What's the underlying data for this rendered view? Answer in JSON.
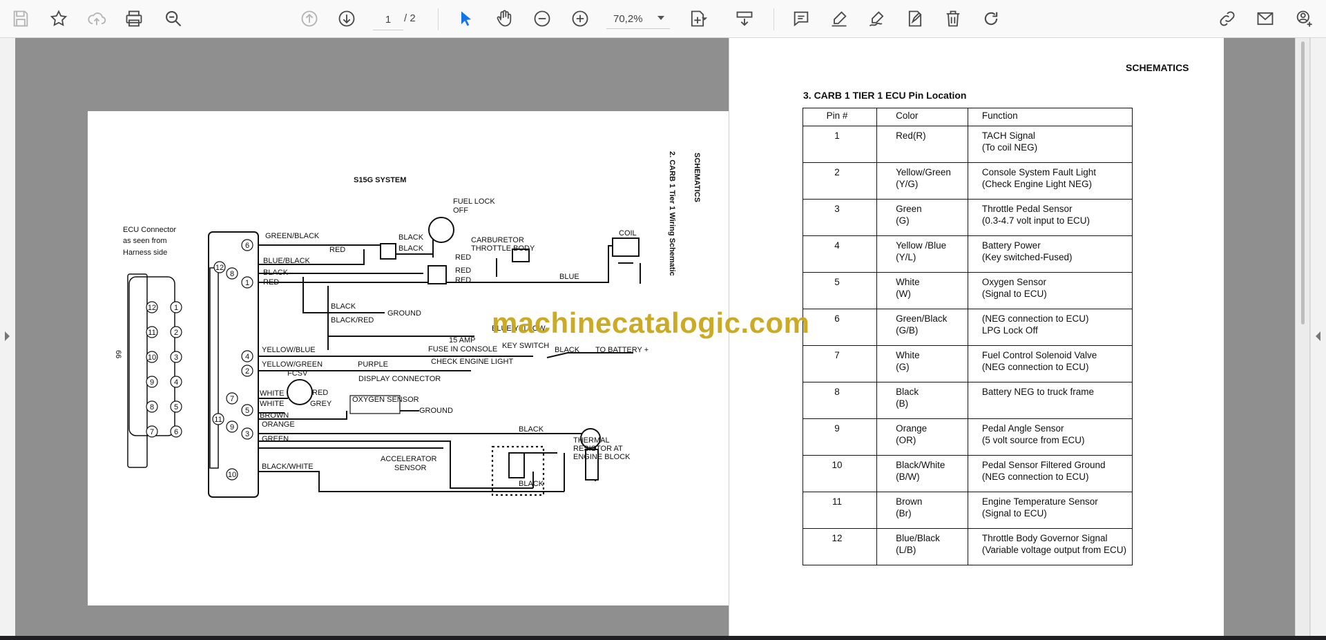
{
  "toolbar": {
    "page_current": "1",
    "page_total": "/ 2",
    "zoom": "70,2%"
  },
  "watermark": "machinecatalogic.com",
  "diagram": {
    "title": "S15G SYSTEM",
    "side_title_1": "SCHEMATICS",
    "side_title_2": "2. CARB 1 Tier 1 Wiring Schematic",
    "page_number": "66",
    "ecu_label_1": "ECU Connector",
    "ecu_label_2": "as seen from",
    "ecu_label_3": "Harness side",
    "labels": {
      "green_black": "GREEN/BLACK",
      "blue_black": "BLUE/BLACK",
      "black1": "BLACK",
      "red1": "RED",
      "red2": "RED",
      "black_a": "BLACK",
      "black_b": "BLACK",
      "red3": "RED",
      "red4": "RED",
      "red5": "RED",
      "blue": "BLUE",
      "fuel_lock_1": "FUEL LOCK",
      "fuel_lock_2": "OFF",
      "carb_1": "CARBURETOR",
      "carb_2": "THROTTLE BODY",
      "coil": "COIL",
      "black_gnd": "BLACK",
      "ground1": "GROUND",
      "black_red": "BLACK/RED",
      "blue_yellow": "BLUE/YELLOW",
      "fuse_1": "15 AMP",
      "fuse_2": "FUSE IN CONSOLE",
      "key_switch": "KEY SWITCH",
      "black_batt": "BLACK",
      "to_battery": "TO BATTERY +",
      "yellow_blue": "YELLOW/BLUE",
      "yellow_green": "YELLOW/GREEN",
      "purple": "PURPLE",
      "check_engine": "CHECK ENGINE LIGHT",
      "display_connector": "DISPLAY CONNECTOR",
      "fcsv": "FCSV",
      "white1": "WHITE",
      "red6": "RED",
      "white2": "WHITE",
      "grey": "GREY",
      "oxygen_sensor": "OXYGEN SENSOR",
      "ground2": "GROUND",
      "brown": "BROWN",
      "orange": "ORANGE",
      "green": "GREEN",
      "black_w1": "BLACK",
      "accel_1": "ACCELERATOR",
      "accel_2": "SENSOR",
      "thermal_1": "THERMAL",
      "thermal_2": "RESISTOR AT",
      "thermal_3": "ENGINE BLOCK",
      "black_white": "BLACK/WHITE",
      "black_w2": "BLACK"
    },
    "ecu_pins": [
      "12",
      "1",
      "11",
      "2",
      "10",
      "3",
      "9",
      "4",
      "8",
      "5",
      "7",
      "6"
    ],
    "harness_pins": [
      "6",
      "12",
      "8",
      "1",
      "4",
      "2",
      "7",
      "5",
      "11",
      "9",
      "3",
      "10"
    ]
  },
  "right_page": {
    "header": "SCHEMATICS",
    "title": "3. CARB 1 TIER 1 ECU Pin Location",
    "columns": [
      "Pin #",
      "Color",
      "Function"
    ],
    "rows": [
      {
        "pin": "1",
        "color": [
          "Red(R)"
        ],
        "function": [
          "TACH Signal",
          "(To coil NEG)"
        ]
      },
      {
        "pin": "2",
        "color": [
          "Yellow/Green",
          "(Y/G)"
        ],
        "function": [
          "Console System Fault Light",
          "(Check Engine Light NEG)"
        ]
      },
      {
        "pin": "3",
        "color": [
          "Green",
          "(G)"
        ],
        "function": [
          "Throttle Pedal Sensor",
          "(0.3-4.7 volt input to ECU)"
        ]
      },
      {
        "pin": "4",
        "color": [
          "Yellow /Blue",
          "(Y/L)"
        ],
        "function": [
          "Battery Power",
          "(Key switched-Fused)"
        ]
      },
      {
        "pin": "5",
        "color": [
          "White",
          "(W)"
        ],
        "function": [
          "Oxygen Sensor",
          "(Signal to ECU)"
        ]
      },
      {
        "pin": "6",
        "color": [
          "Green/Black",
          "(G/B)"
        ],
        "function": [
          "(NEG connection to ECU)",
          "LPG Lock Off"
        ]
      },
      {
        "pin": "7",
        "color": [
          "White",
          "(G)"
        ],
        "function": [
          "Fuel Control Solenoid Valve",
          "(NEG connection to ECU)"
        ]
      },
      {
        "pin": "8",
        "color": [
          "Black",
          "(B)"
        ],
        "function": [
          "Battery NEG to truck frame"
        ]
      },
      {
        "pin": "9",
        "color": [
          "Orange",
          "(OR)"
        ],
        "function": [
          "Pedal Angle Sensor",
          "(5 volt source from ECU)"
        ]
      },
      {
        "pin": "10",
        "color": [
          "Black/White",
          "(B/W)"
        ],
        "function": [
          "Pedal Sensor Filtered Ground",
          "(NEG connection to ECU)"
        ]
      },
      {
        "pin": "11",
        "color": [
          "Brown",
          "(Br)"
        ],
        "function": [
          "Engine Temperature Sensor",
          "(Signal to ECU)"
        ]
      },
      {
        "pin": "12",
        "color": [
          "Blue/Black",
          "(L/B)"
        ],
        "function": [
          "Throttle Body Governor Signal",
          "(Variable voltage output from ECU)"
        ]
      }
    ]
  }
}
